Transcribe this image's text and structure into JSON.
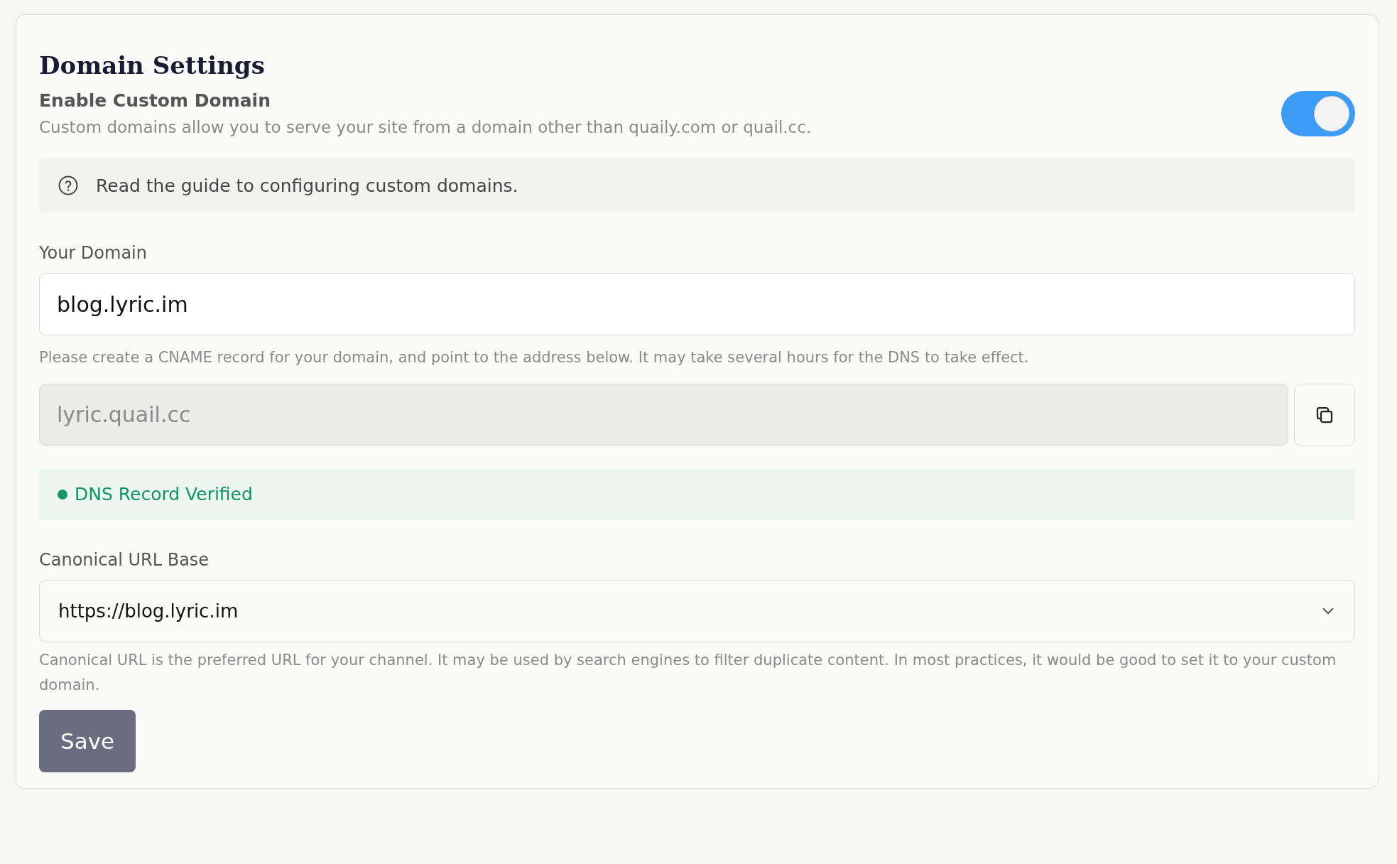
{
  "title": "Domain Settings",
  "custom_domain": {
    "label": "Enable Custom Domain",
    "description": "Custom domains allow you to serve your site from a domain other than quaily.com or quail.cc.",
    "on": true
  },
  "guide": {
    "text": "Read the guide to configuring custom domains."
  },
  "your_domain": {
    "label": "Your Domain",
    "value": "blog.lyric.im",
    "help": "Please create a CNAME record for your domain, and point to the address below. It may take several hours for the DNS to take effect."
  },
  "cname_target": {
    "value": "lyric.quail.cc"
  },
  "dns_status": {
    "text": "DNS Record Verified",
    "verified": true
  },
  "canonical": {
    "label": "Canonical URL Base",
    "value": "https://blog.lyric.im",
    "help": "Canonical URL is the preferred URL for your channel. It may be used by search engines to filter duplicate content. In most practices, it would be good to set it to your custom domain."
  },
  "save_button": "Save"
}
